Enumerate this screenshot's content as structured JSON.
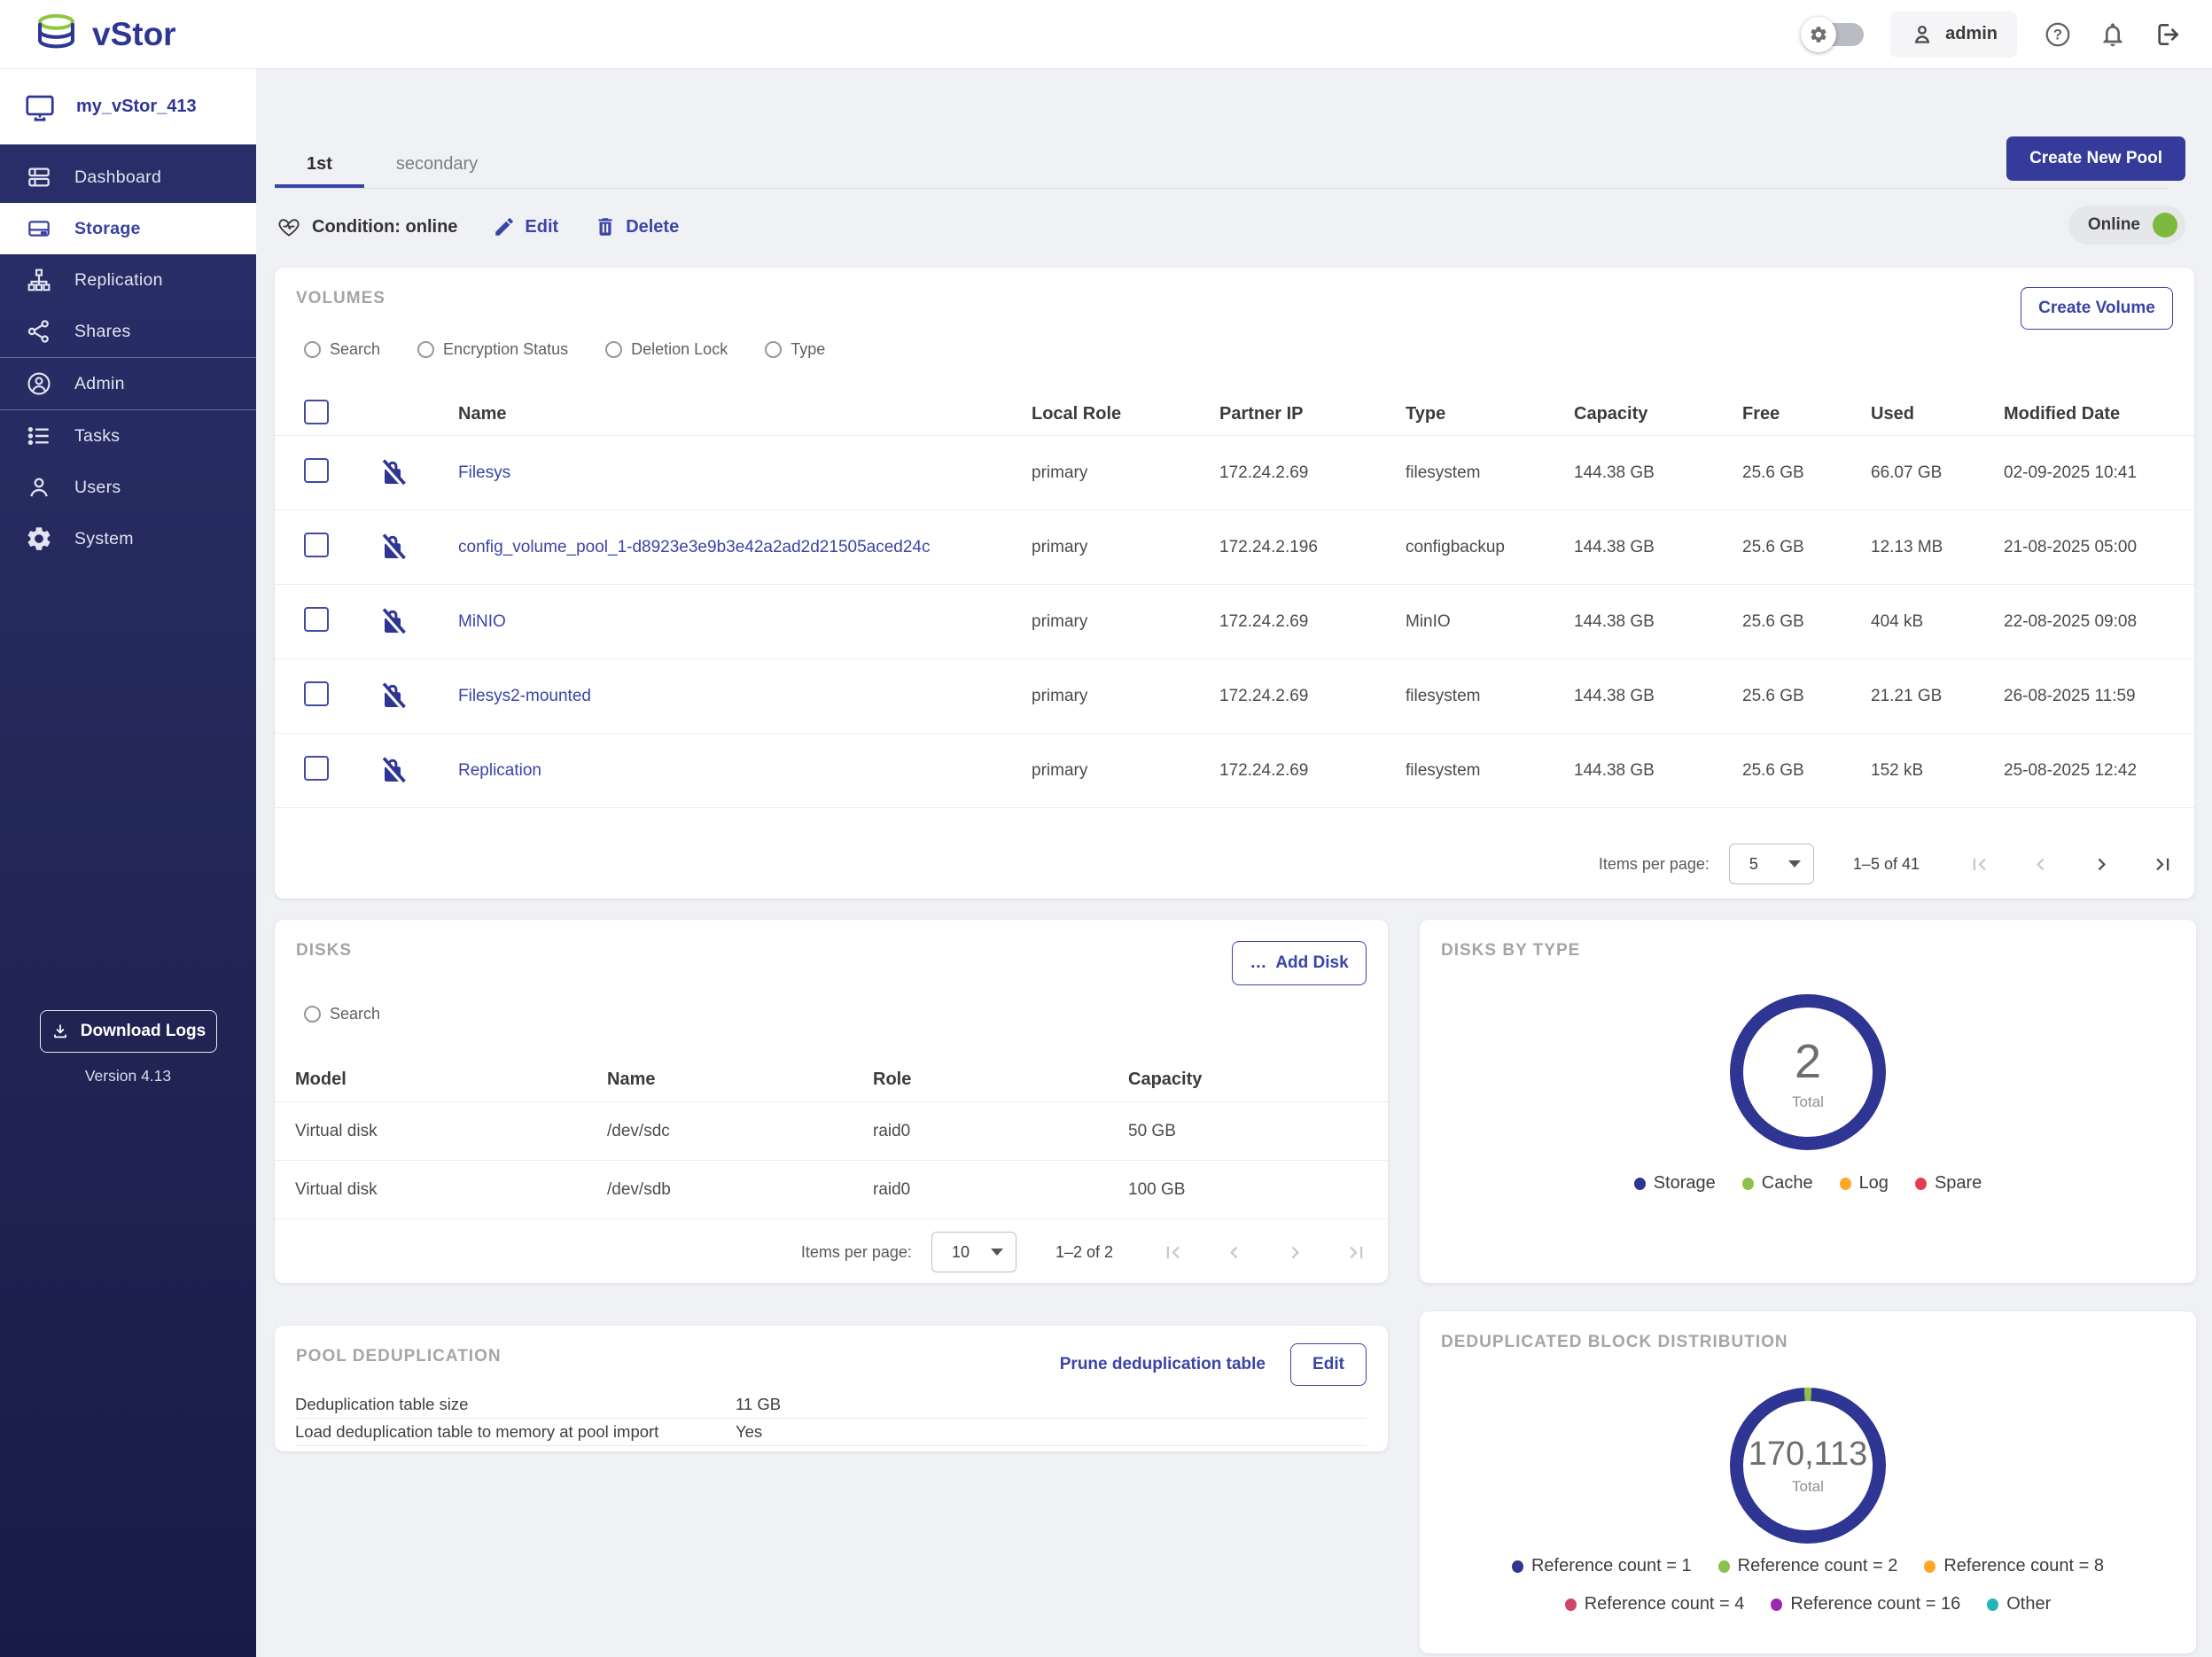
{
  "icons": {
    "ellipsis": "…",
    "help": "?"
  },
  "topbar": {
    "logo_text": "vStor",
    "user_label": "admin"
  },
  "sidebar": {
    "server_name": "my_vStor_413",
    "items": [
      {
        "label": "Dashboard"
      },
      {
        "label": "Storage"
      },
      {
        "label": "Replication"
      },
      {
        "label": "Shares"
      },
      {
        "label": "Admin"
      },
      {
        "label": "Tasks"
      },
      {
        "label": "Users"
      },
      {
        "label": "System"
      }
    ],
    "download_logs_label": "Download Logs",
    "version": "Version 4.13"
  },
  "pool": {
    "create_new_pool_label": "Create New Pool",
    "tab_primary": "1st",
    "tab_secondary": "secondary",
    "condition_label": "Condition: online",
    "edit_label": "Edit",
    "delete_label": "Delete",
    "online_label": "Online",
    "online_color": "#7db93f"
  },
  "volumes": {
    "title": "VOLUMES",
    "create_volume_label": "Create Volume",
    "filters": [
      "Search",
      "Encryption Status",
      "Deletion Lock",
      "Type"
    ],
    "columns": [
      "Name",
      "Local Role",
      "Partner IP",
      "Type",
      "Capacity",
      "Free",
      "Used",
      "Modified Date"
    ],
    "rows": [
      {
        "name": "Filesys",
        "local_role": "primary",
        "partner_ip": "172.24.2.69",
        "type": "filesystem",
        "capacity": "144.38 GB",
        "free": "25.6 GB",
        "used": "66.07 GB",
        "modified": "02-09-2025 10:41"
      },
      {
        "name": "config_volume_pool_1-d8923e3e9b3e42a2ad2d21505aced24c",
        "local_role": "primary",
        "partner_ip": "172.24.2.196",
        "type": "configbackup",
        "capacity": "144.38 GB",
        "free": "25.6 GB",
        "used": "12.13 MB",
        "modified": "21-08-2025 05:00"
      },
      {
        "name": "MiNIO",
        "local_role": "primary",
        "partner_ip": "172.24.2.69",
        "type": "MinIO",
        "capacity": "144.38 GB",
        "free": "25.6 GB",
        "used": "404 kB",
        "modified": "22-08-2025 09:08"
      },
      {
        "name": "Filesys2-mounted",
        "local_role": "primary",
        "partner_ip": "172.24.2.69",
        "type": "filesystem",
        "capacity": "144.38 GB",
        "free": "25.6 GB",
        "used": "21.21 GB",
        "modified": "26-08-2025 11:59"
      },
      {
        "name": "Replication",
        "local_role": "primary",
        "partner_ip": "172.24.2.69",
        "type": "filesystem",
        "capacity": "144.38 GB",
        "free": "25.6 GB",
        "used": "152 kB",
        "modified": "25-08-2025 12:42"
      }
    ],
    "pagination": {
      "items_per_page_label": "Items per page:",
      "items_per_page": "5",
      "range": "1–5 of 41"
    }
  },
  "disks": {
    "title": "DISKS",
    "add_disk_label": "Add Disk",
    "search_label": "Search",
    "columns": [
      "Model",
      "Name",
      "Role",
      "Capacity"
    ],
    "rows": [
      {
        "model": "Virtual disk",
        "name": "/dev/sdc",
        "role": "raid0",
        "capacity": "50 GB"
      },
      {
        "model": "Virtual disk",
        "name": "/dev/sdb",
        "role": "raid0",
        "capacity": "100 GB"
      }
    ],
    "pagination": {
      "items_per_page_label": "Items per page:",
      "items_per_page": "10",
      "range": "1–2 of 2"
    }
  },
  "dedup": {
    "title": "POOL DEDUPLICATION",
    "prune_label": "Prune deduplication table",
    "edit_label": "Edit",
    "rows": [
      {
        "label": "Deduplication table size",
        "value": "11 GB"
      },
      {
        "label": "Load deduplication table to memory at pool import",
        "value": "Yes"
      }
    ]
  },
  "chart_data": [
    {
      "type": "pie",
      "title": "DISKS BY TYPE",
      "total": "2",
      "total_label": "Total",
      "legend_position": "bottom",
      "series": [
        {
          "name": "Storage",
          "value": 2,
          "color": "#2e3593"
        },
        {
          "name": "Cache",
          "value": 0,
          "color": "#8bc34a"
        },
        {
          "name": "Log",
          "value": 0,
          "color": "#ffa726"
        },
        {
          "name": "Spare",
          "value": 0,
          "color": "#e23e50"
        }
      ]
    },
    {
      "type": "pie",
      "title": "DEDUPLICATED BLOCK DISTRIBUTION",
      "total": "170,113",
      "total_label": "Total",
      "legend_position": "bottom",
      "series": [
        {
          "name": "Reference count = 1",
          "value": 167558,
          "color": "#2e3593"
        },
        {
          "name": "Reference count = 2",
          "value": 2555,
          "color": "#8bc34a"
        },
        {
          "name": "Reference count = 8",
          "value": 0,
          "color": "#ffa726"
        },
        {
          "name": "Reference count = 4",
          "value": 0,
          "color": "#d04468"
        },
        {
          "name": "Reference count = 16",
          "value": 0,
          "color": "#9c27b0"
        },
        {
          "name": "Other",
          "value": 0,
          "color": "#26b4b8"
        }
      ]
    }
  ]
}
